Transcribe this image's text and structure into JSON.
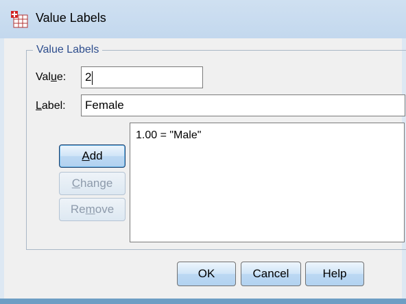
{
  "window": {
    "title": "Value Labels"
  },
  "group": {
    "legend": "Value Labels"
  },
  "value_field": {
    "label_pre": "Val",
    "label_accel": "u",
    "label_post": "e:",
    "value": "2"
  },
  "label_field": {
    "label_accel": "L",
    "label_post": "abel:",
    "value": "Female"
  },
  "list": {
    "items": [
      "1.00 = \"Male\""
    ]
  },
  "buttons": {
    "add": {
      "accel": "A",
      "rest": "dd"
    },
    "change": {
      "accel": "C",
      "rest": "hange"
    },
    "remove": {
      "pre": "Re",
      "accel": "m",
      "rest": "ove"
    },
    "ok": "OK",
    "cancel": "Cancel",
    "help": "Help"
  },
  "colors": {
    "legend_text": "#2d4d8d",
    "button_face": "#bcd8f3",
    "default_border": "#1b3e6b"
  }
}
